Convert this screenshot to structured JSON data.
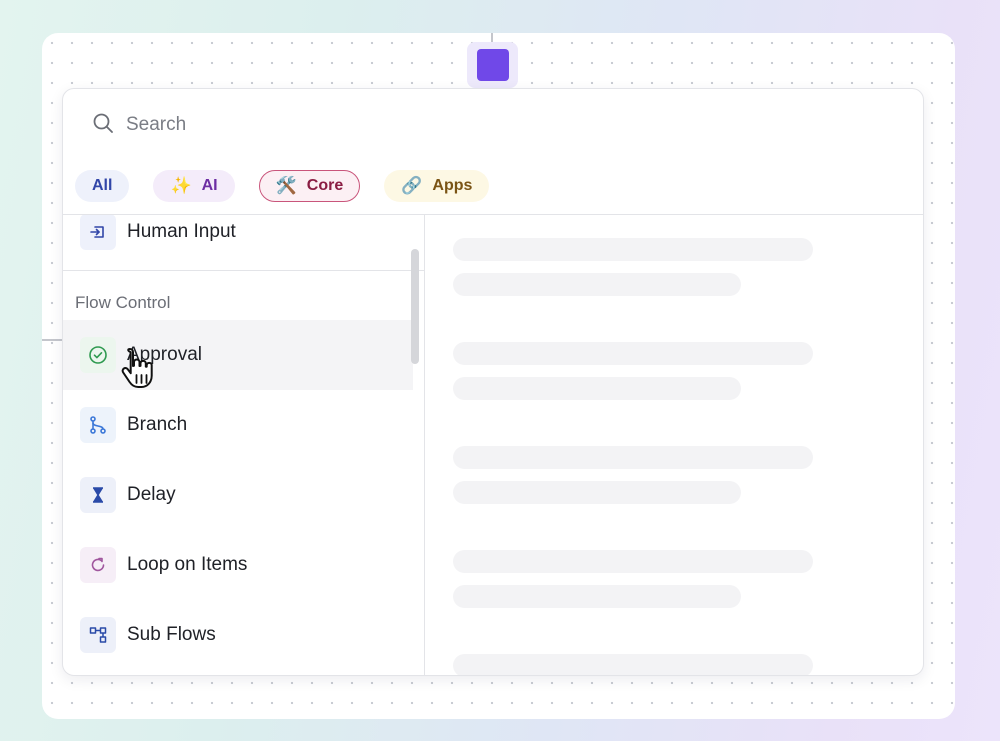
{
  "search": {
    "placeholder": "Search",
    "value": ""
  },
  "chips": [
    {
      "label": "All",
      "emoji": ""
    },
    {
      "label": "AI",
      "emoji": "✨"
    },
    {
      "label": "Core",
      "emoji": "🛠️"
    },
    {
      "label": "Apps",
      "emoji": "🔗"
    }
  ],
  "list": {
    "top_item": {
      "label": "Human Input",
      "icon": "input-arrow-icon"
    },
    "section_title": "Flow Control",
    "items": [
      {
        "label": "Approval",
        "icon": "check-circle-icon"
      },
      {
        "label": "Branch",
        "icon": "branch-icon"
      },
      {
        "label": "Delay",
        "icon": "hourglass-icon"
      },
      {
        "label": "Loop on Items",
        "icon": "loop-icon"
      },
      {
        "label": "Sub Flows",
        "icon": "sub-flow-icon"
      }
    ]
  },
  "colors": {
    "node": "#7048e8",
    "chip_all": "#3146a8",
    "chip_ai": "#6d2ea3",
    "chip_core": "#8a1d43",
    "chip_apps": "#7a5415"
  }
}
